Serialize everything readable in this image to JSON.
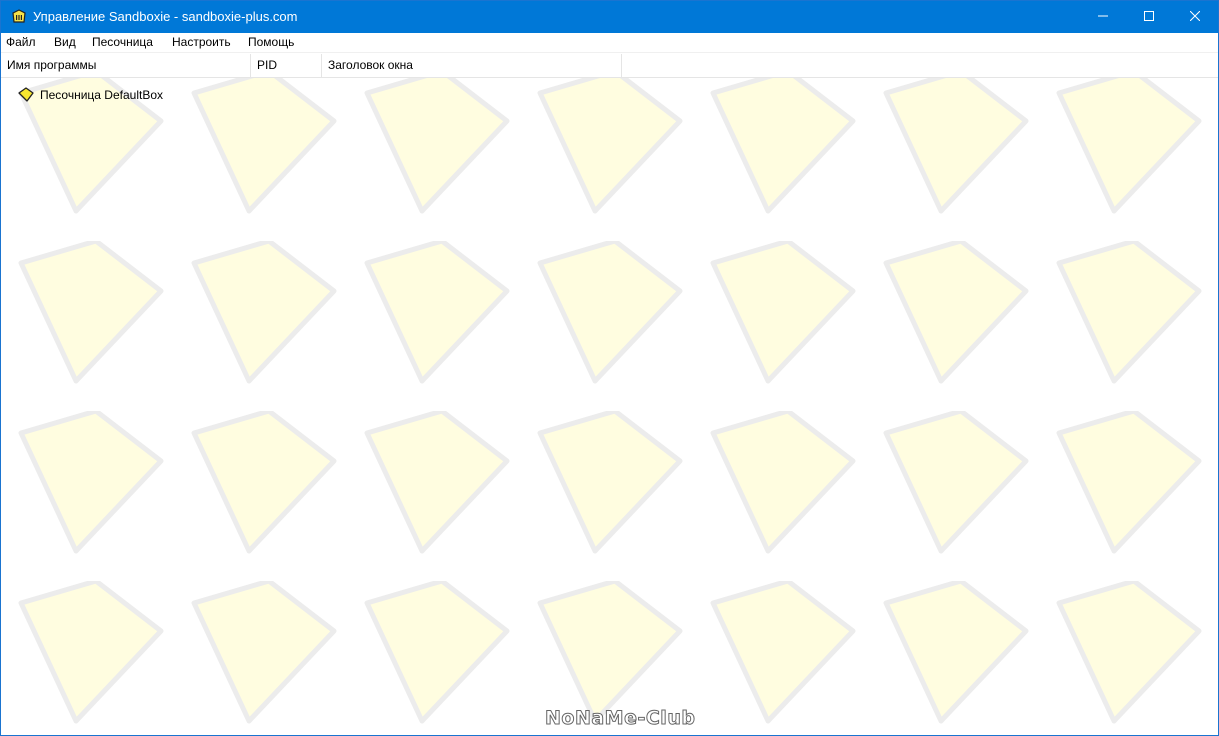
{
  "window": {
    "title": "Управление Sandboxie - sandboxie-plus.com",
    "app_icon": "sandboxie-icon",
    "titlebar_color": "#0078d7",
    "controls": {
      "minimize_icon": "minimize-icon",
      "maximize_icon": "maximize-icon",
      "close_icon": "close-icon"
    }
  },
  "menubar": {
    "items": [
      {
        "label": "Файл"
      },
      {
        "label": "Вид"
      },
      {
        "label": "Песочница"
      },
      {
        "label": "Настроить"
      },
      {
        "label": "Помощь"
      }
    ]
  },
  "table": {
    "columns": [
      {
        "label": "Имя программы"
      },
      {
        "label": "PID"
      },
      {
        "label": "Заголовок окна"
      }
    ],
    "rows": [
      {
        "icon": "sandbox-icon",
        "label": "Песочница DefaultBox"
      }
    ]
  },
  "background": {
    "pattern": "yellow-sandbox-shapes",
    "fill_color": "#fffde0",
    "stroke_color": "#ececec"
  },
  "watermark": "NoNaMe-Club"
}
